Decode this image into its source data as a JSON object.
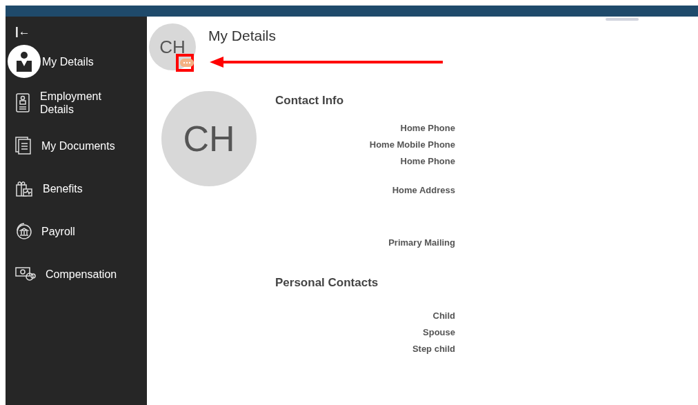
{
  "sidebar": {
    "collapse_icon": "|←",
    "items": [
      {
        "label": "My Details",
        "selected": true
      },
      {
        "label": "Employment Details",
        "selected": false
      },
      {
        "label": "My Documents",
        "selected": false
      },
      {
        "label": "Benefits",
        "selected": false
      },
      {
        "label": "Payroll",
        "selected": false
      },
      {
        "label": "Compensation",
        "selected": false
      }
    ]
  },
  "header": {
    "initials": "CH",
    "title": "My Details"
  },
  "profile": {
    "initials": "CH"
  },
  "contact_info": {
    "heading": "Contact Info",
    "groups": [
      [
        "Home Phone",
        "Home Mobile Phone",
        "Home Phone"
      ],
      [
        "Home Address"
      ],
      [
        "Primary Mailing"
      ]
    ]
  },
  "personal_contacts": {
    "heading": "Personal Contacts",
    "items": [
      "Child",
      "Spouse",
      "Step child"
    ]
  }
}
